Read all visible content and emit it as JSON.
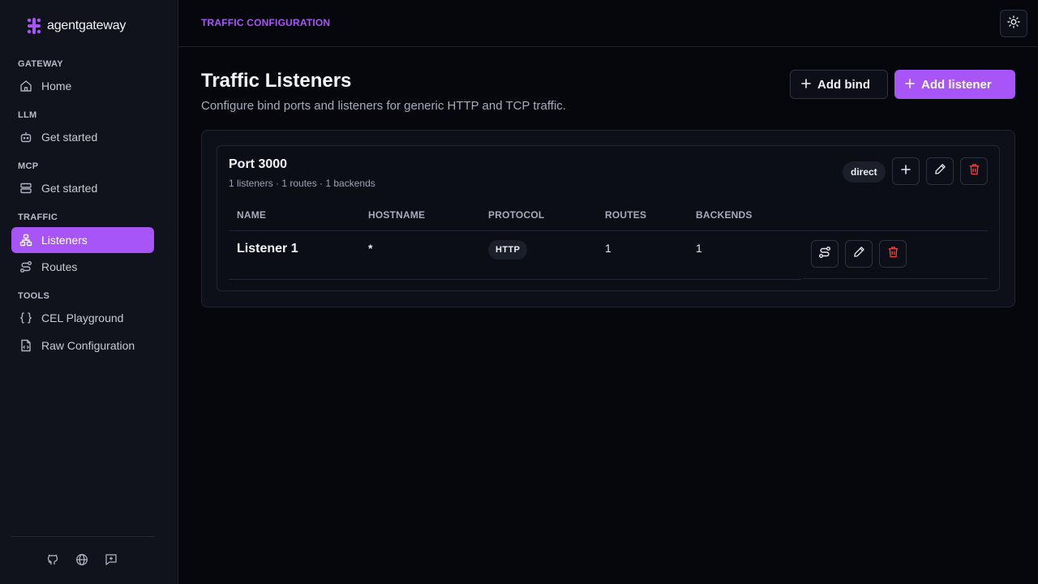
{
  "app": {
    "name": "agentgateway"
  },
  "sidebar": {
    "sections": [
      {
        "label": "GATEWAY",
        "items": [
          {
            "label": "Home",
            "icon": "home-icon"
          }
        ]
      },
      {
        "label": "LLM",
        "items": [
          {
            "label": "Get started",
            "icon": "bot-icon"
          }
        ]
      },
      {
        "label": "MCP",
        "items": [
          {
            "label": "Get started",
            "icon": "server-icon"
          }
        ]
      },
      {
        "label": "TRAFFIC",
        "items": [
          {
            "label": "Listeners",
            "icon": "network-icon",
            "active": true
          },
          {
            "label": "Routes",
            "icon": "route-icon"
          }
        ]
      },
      {
        "label": "TOOLS",
        "items": [
          {
            "label": "CEL Playground",
            "icon": "braces-icon"
          },
          {
            "label": "Raw Configuration",
            "icon": "file-code-icon"
          }
        ]
      }
    ],
    "footer_icons": [
      "github-icon",
      "globe-icon",
      "feedback-icon"
    ]
  },
  "header": {
    "breadcrumb": "TRAFFIC CONFIGURATION",
    "theme_icon": "sun-icon"
  },
  "page": {
    "title": "Traffic Listeners",
    "subtitle": "Configure bind ports and listeners for generic HTTP and TCP traffic.",
    "add_bind_label": "Add bind",
    "add_listener_label": "Add listener"
  },
  "bind": {
    "title": "Port 3000",
    "meta": "1 listeners · 1 routes · 1 backends",
    "badge": "direct",
    "columns": [
      "NAME",
      "HOSTNAME",
      "PROTOCOL",
      "ROUTES",
      "BACKENDS"
    ],
    "rows": [
      {
        "name": "Listener 1",
        "hostname": "*",
        "protocol": "HTTP",
        "routes": "1",
        "backends": "1"
      }
    ]
  },
  "colors": {
    "accent": "#a855f7",
    "danger": "#ef4444",
    "background": "#05070d",
    "sidebar": "#10131c"
  }
}
